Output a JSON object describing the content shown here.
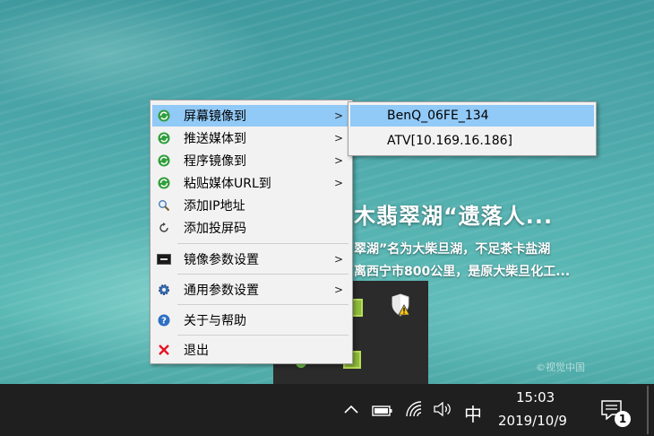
{
  "wallpaper": {
    "caption_title": "木翡翠湖“遗落人...",
    "caption_line1": "翠湖”名为大柴旦湖，不足茶卡盐湖",
    "caption_line2": "离西宁市800公里，是原大柴旦化工...",
    "watermark": "©视觉中国"
  },
  "context_menu": {
    "items": [
      {
        "label": "屏幕镜像到",
        "icon": "cast-green-icon",
        "has_submenu": true
      },
      {
        "label": "推送媒体到",
        "icon": "cast-green-icon",
        "has_submenu": true
      },
      {
        "label": "程序镜像到",
        "icon": "cast-green-icon",
        "has_submenu": true
      },
      {
        "label": "粘贴媒体URL到",
        "icon": "cast-green-icon",
        "has_submenu": true
      },
      {
        "label": "添加IP地址",
        "icon": "magnifier-icon",
        "has_submenu": false
      },
      {
        "label": "添加投屏码",
        "icon": "refresh-icon",
        "has_submenu": false
      },
      {
        "label": "镜像参数设置",
        "icon": "monitor-icon",
        "has_submenu": true
      },
      {
        "label": "通用参数设置",
        "icon": "gear-icon",
        "has_submenu": true
      },
      {
        "label": "关于与帮助",
        "icon": "help-icon",
        "has_submenu": false
      },
      {
        "label": "退出",
        "icon": "close-x-icon",
        "has_submenu": false
      }
    ],
    "submenu_arrow": ">"
  },
  "submenu": {
    "items": [
      {
        "label": "BenQ_06FE_134"
      },
      {
        "label": "ATV[10.169.16.186]"
      }
    ]
  },
  "taskbar": {
    "time": "15:03",
    "date": "2019/10/9",
    "ime": "中",
    "notification_count": "1",
    "tray_icons": [
      "chevron-up-icon",
      "battery-icon",
      "wifi-icon",
      "volume-icon"
    ]
  },
  "colors": {
    "menu_bg": "#f2f2f2",
    "highlight": "#91c9f7",
    "taskbar": "#1f1f1f",
    "exit_red": "#e81123"
  }
}
